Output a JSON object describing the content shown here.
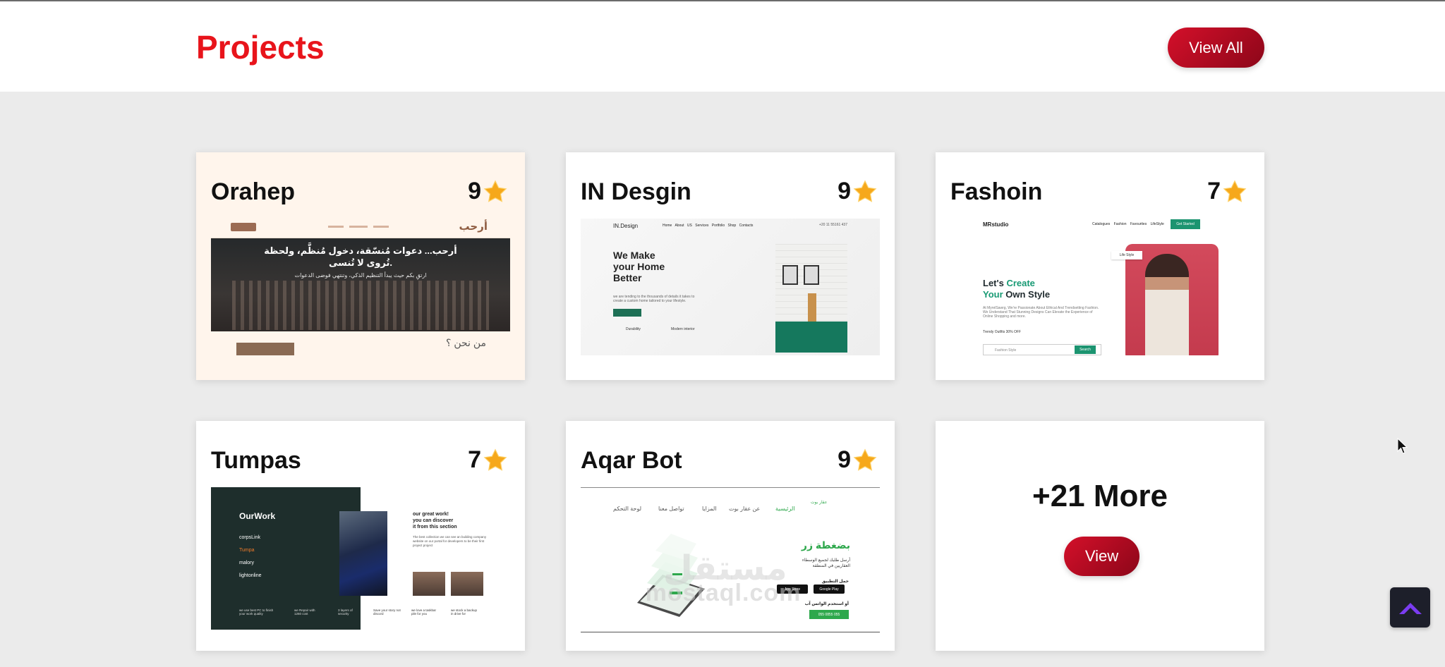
{
  "header": {
    "title": "Projects",
    "view_all_label": "View All"
  },
  "projects": [
    {
      "name": "Orahep",
      "rating": "9",
      "preview": {
        "logo": "أرحب",
        "headline_1": "أرحب... دعوات مُنسّقة، دخول مُنظَّم، ولحظة",
        "headline_2": "تُروى لا تُنسى.",
        "subline": "ارتقِ بكم حيث يبدأ التنظيم الذكي، وتنتهي فوضى الدعوات",
        "about": "من نحن ؟"
      }
    },
    {
      "name": "IN Desgin",
      "rating": "9",
      "preview": {
        "logo": "IN.Design",
        "nav": "Home  About US  Services  Portfolio  Shop  Contacts",
        "phone": "+20 11 55161 437",
        "headline": [
          "We Make",
          "your Home",
          "Better"
        ],
        "body": "we are tending to the thousands of details it takes to create a custom home tailored to your lifestyle.",
        "feature_1": "Durability",
        "feature_2": "Modern interior"
      }
    },
    {
      "name": "Fashoin",
      "rating": "7",
      "preview": {
        "logo": "MRstudio",
        "nav": "Catalogues  Fashion  Favourites  LifeStyle",
        "cta": "Get Started",
        "headline_pre": "Let's ",
        "headline_accent": "Create",
        "headline_line2_accent": "Your",
        "headline_line2": " Own Style",
        "body": "At MyrelSawrg, We're Passionate About Ethical And Trendsetting Fashion. We Understand That Stunning Designs Can Elevate the Experience of Online Shopping and more.",
        "offer": "Trendy Outfits   30% OFF",
        "search_placeholder": "Fashion Style",
        "search_button": "Search",
        "tag": "Life Style"
      }
    },
    {
      "name": "Tumpas",
      "rating": "7",
      "preview": {
        "heading": "OurWork",
        "items": [
          "corpsLink",
          "Tumpa",
          "malory",
          "lightonline"
        ],
        "right_heading": [
          "our great work!",
          "you can discover",
          "it from this section"
        ],
        "right_body": "The best collection we can see an building company website on our portal for developers to be their first project project",
        "footer": [
          "we use best PC to finish your work quality",
          "we Repair with 1260 cost",
          "3 layers of security",
          "Save your story not discord",
          "we love a taskbar pile for you",
          "we stock a backup in drive for"
        ]
      }
    },
    {
      "name": "Aqar Bot",
      "rating": "9",
      "preview": {
        "nav": [
          "الرئيسية",
          "عن عقار بوت",
          "المزايا",
          "تواصل معنا",
          "لوحة التحكم"
        ],
        "logo": "عقار بوت",
        "headline": "بضغطة زر",
        "body": [
          "أرسل طلبك لجميع الوسطاء",
          "العقاريين في المنطقة"
        ],
        "download": "حمل التطبيق",
        "store_1": "App Store",
        "store_2": "Google Play",
        "whatsapp": "أو استخدم الواتس آب",
        "cta": "055 0855 055"
      }
    }
  ],
  "more": {
    "title": "+21 More",
    "button": "View"
  },
  "watermark": {
    "text": "mostaql.com",
    "arabic": "مستقل"
  },
  "colors": {
    "accent": "#e8141b",
    "button": "#b80a22",
    "star": "#f6a81b"
  },
  "icons": {
    "star": "star-icon",
    "scroll_top": "chevron-up-icon"
  }
}
